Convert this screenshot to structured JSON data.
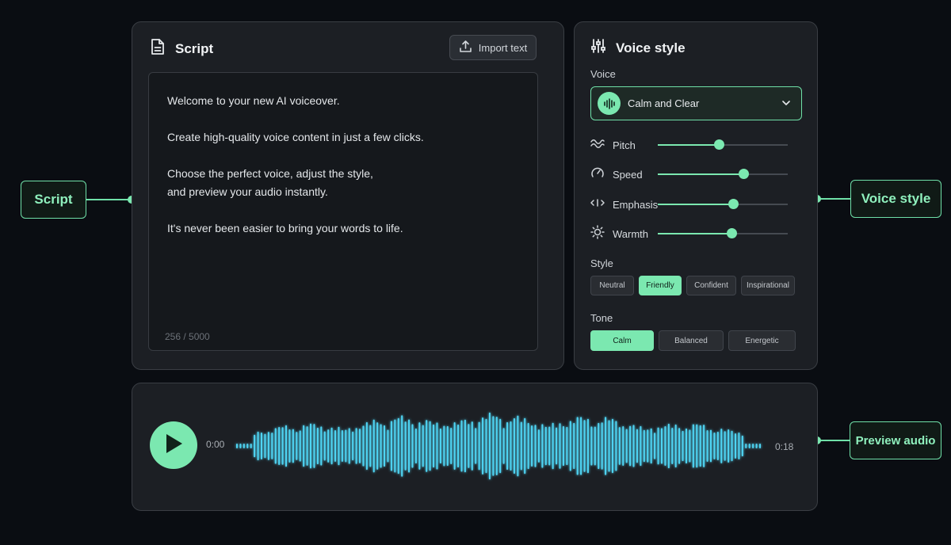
{
  "script_panel": {
    "title": "Script",
    "import_label": "Import text",
    "paragraphs": [
      "Welcome to your new AI voiceover.",
      "Create high-quality voice content in just a few clicks.",
      "Choose the perfect voice, adjust the style,\nand preview your audio instantly.",
      "It's never been easier to bring your words to life."
    ],
    "char_count": "256 / 5000"
  },
  "voice_panel": {
    "title": "Voice style",
    "voice_label": "Voice",
    "voice_value": "Calm and Clear",
    "sliders": [
      {
        "label": "Pitch",
        "value": 0.47,
        "icon": "wave-icon"
      },
      {
        "label": "Speed",
        "value": 0.66,
        "icon": "gauge-icon"
      },
      {
        "label": "Emphasis",
        "value": 0.58,
        "icon": "emphasis-icon"
      },
      {
        "label": "Warmth",
        "value": 0.57,
        "icon": "sun-icon"
      }
    ],
    "style_label": "Style",
    "style_options": [
      "Neutral",
      "Friendly",
      "Confident",
      "Inspirational"
    ],
    "style_selected": "Friendly",
    "tone_label": "Tone",
    "tone_options": [
      "Calm",
      "Balanced",
      "Energetic"
    ],
    "tone_selected": "Calm"
  },
  "player": {
    "current_time": "0:00",
    "duration": "0:18",
    "progress": 0
  },
  "callouts": {
    "script": "Script",
    "voice_style": "Voice style",
    "preview_audio": "Preview audio"
  },
  "colors": {
    "accent": "#7be8b0",
    "waveform": "#4fd6f5",
    "background": "#0a0d12",
    "panel": "#1c1f24"
  }
}
